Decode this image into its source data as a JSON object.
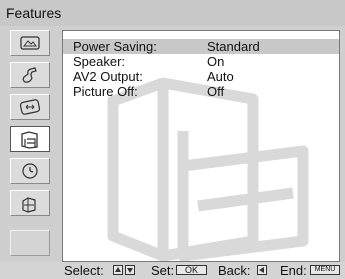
{
  "header": {
    "title": "Features"
  },
  "sidebar": {
    "items": [
      {
        "icon": "picture-icon",
        "active": false
      },
      {
        "icon": "sound-icon",
        "active": false
      },
      {
        "icon": "screen-icon",
        "active": false
      },
      {
        "icon": "features-icon",
        "active": true
      },
      {
        "icon": "timer-icon",
        "active": false
      },
      {
        "icon": "setup-icon",
        "active": false
      }
    ]
  },
  "menu": {
    "rows": [
      {
        "label": "Power Saving:",
        "value": "Standard",
        "selected": true
      },
      {
        "label": "Speaker:",
        "value": "On",
        "selected": false
      },
      {
        "label": "AV2  Output:",
        "value": "Auto",
        "selected": false
      },
      {
        "label": "Picture Off:",
        "value": "Off",
        "selected": false
      }
    ]
  },
  "footer": {
    "select_label": "Select:",
    "set_label": "Set:",
    "set_key": "OK",
    "back_label": "Back:",
    "end_label": "End:",
    "end_key": "MENU"
  }
}
